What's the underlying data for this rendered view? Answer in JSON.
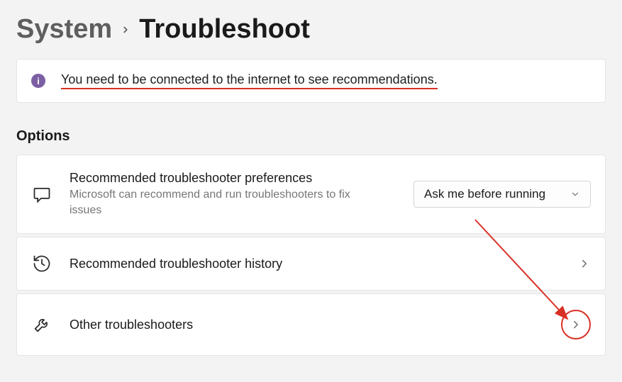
{
  "breadcrumb": {
    "parent": "System",
    "current": "Troubleshoot"
  },
  "banner": {
    "text": "You need to be connected to the internet to see recommendations."
  },
  "section_title": "Options",
  "cards": {
    "preferences": {
      "title": "Recommended troubleshooter preferences",
      "subtitle": "Microsoft can recommend and run troubleshooters to fix issues"
    },
    "history": {
      "title": "Recommended troubleshooter history"
    },
    "other": {
      "title": "Other troubleshooters"
    }
  },
  "select": {
    "value": "Ask me before running"
  }
}
